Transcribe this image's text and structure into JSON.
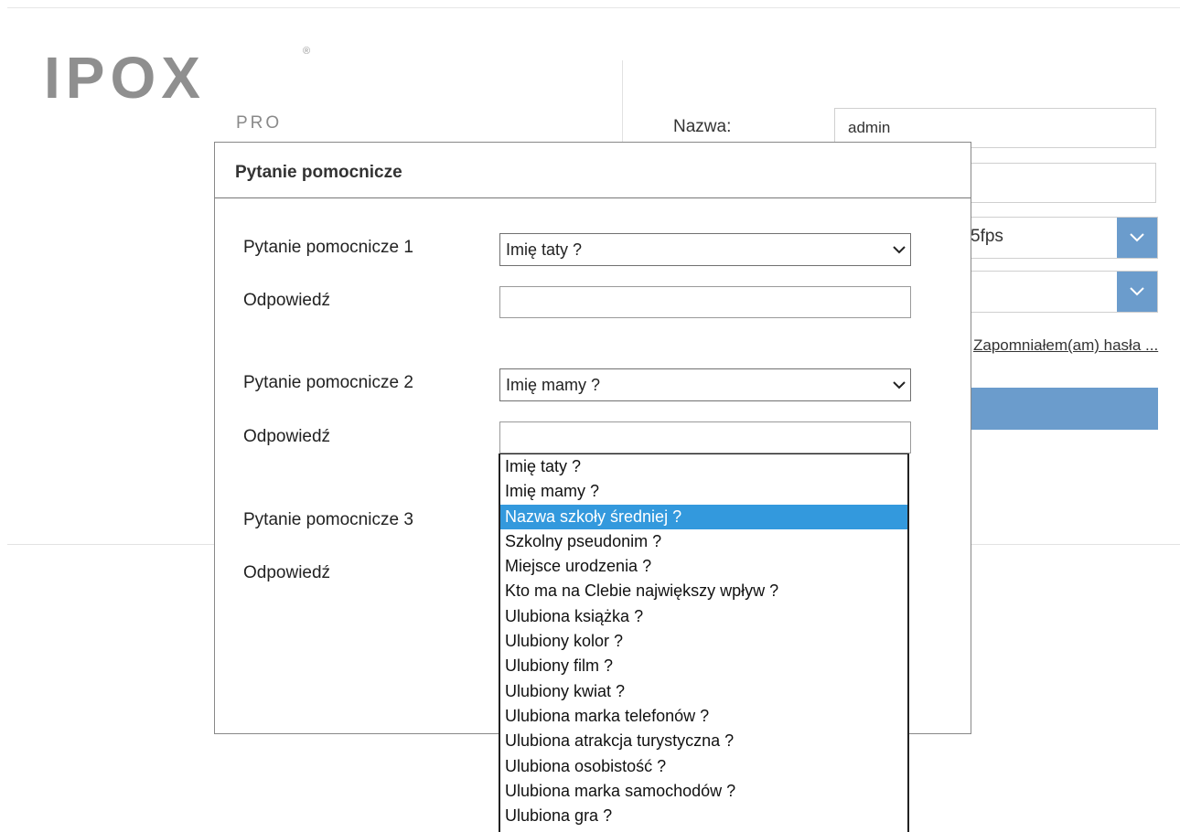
{
  "logo": {
    "text": "IPOX",
    "sub": "PRO",
    "reg": "®"
  },
  "login": {
    "name_label": "Nazwa:",
    "name_value": "admin",
    "stream_value": "5fps",
    "forgot_link": "Zapomniałem(am) hasła ..."
  },
  "colors": {
    "accent": "#6b9ccc",
    "highlight": "#3399dd"
  },
  "modal": {
    "title": "Pytanie pomocnicze",
    "question1_label": "Pytanie pomocnicze 1",
    "question1_value": "Imię taty ?",
    "answer1_label": "Odpowiedź",
    "answer1_value": "",
    "question2_label": "Pytanie pomocnicze 2",
    "question2_value": "Imię mamy ?",
    "answer2_label": "Odpowiedź",
    "answer2_value": "",
    "question3_label": "Pytanie pomocnicze 3",
    "answer3_label": "Odpowiedź"
  },
  "dropdown": {
    "selected_index": 2,
    "options": [
      "Imię taty ?",
      "Imię mamy ?",
      "Nazwa szkoły średniej ?",
      "Szkolny pseudonim ?",
      "Miejsce urodzenia ?",
      "Kto ma na Clebie największy wpływ ?",
      "Ulubiona książka ?",
      "Ulubiony kolor ?",
      "Ulubiony film ?",
      "Ulubiony kwiat ?",
      "Ulubiona marka telefonów ?",
      "Ulubiona atrakcja turystyczna ?",
      "Ulubiona osobistość ?",
      "Ulubiona marka samochodów ?",
      "Ulubiona gra ?"
    ]
  },
  "icons": {
    "dropdown_arrow": "chevron-down-icon"
  }
}
